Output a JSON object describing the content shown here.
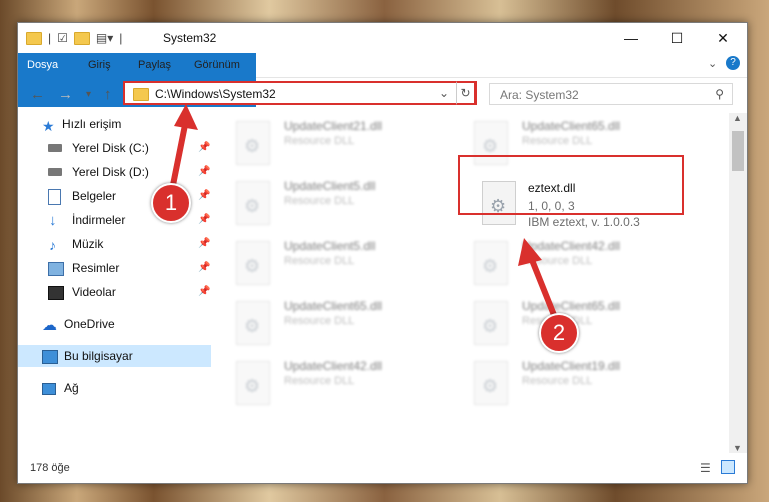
{
  "window": {
    "title": "System32"
  },
  "ribbon": {
    "tabs": [
      "Dosya",
      "Giriş",
      "Paylaş",
      "Görünüm"
    ]
  },
  "address": {
    "path": "C:\\Windows\\System32"
  },
  "search": {
    "placeholder": "Ara: System32"
  },
  "sidebar": {
    "items": [
      {
        "label": "Hızlı erişim",
        "icon": "star-icon",
        "pinned": false
      },
      {
        "label": "Yerel Disk (C:)",
        "icon": "drive-icon",
        "pinned": true
      },
      {
        "label": "Yerel Disk (D:)",
        "icon": "drive-icon",
        "pinned": true
      },
      {
        "label": "Belgeler",
        "icon": "documents-icon",
        "pinned": true
      },
      {
        "label": "İndirmeler",
        "icon": "download-icon",
        "pinned": true
      },
      {
        "label": "Müzik",
        "icon": "music-icon",
        "pinned": true
      },
      {
        "label": "Resimler",
        "icon": "pictures-icon",
        "pinned": true
      },
      {
        "label": "Videolar",
        "icon": "video-icon",
        "pinned": true
      },
      {
        "label": "OneDrive",
        "icon": "cloud-icon",
        "pinned": false
      },
      {
        "label": "Bu bilgisayar",
        "icon": "computer-icon",
        "pinned": false
      },
      {
        "label": "Ağ",
        "icon": "network-icon",
        "pinned": false
      }
    ]
  },
  "files": [
    {
      "name": "UpdateClient21.dll",
      "desc": "Resource DLL"
    },
    {
      "name": "UpdateClient65.dll",
      "desc": "Resource DLL"
    },
    {
      "name": "UpdateClient5.dll",
      "desc": "Resource DLL"
    },
    {
      "name": "eztext.dll",
      "desc": "1, 0, 0, 3",
      "desc2": "IBM eztext, v. 1.0.0.3"
    },
    {
      "name": "UpdateClient5.dll",
      "desc": "Resource DLL"
    },
    {
      "name": "UpdateClient42.dll",
      "desc": "Resource DLL"
    },
    {
      "name": "UpdateClient65.dll",
      "desc": "Resource DLL"
    },
    {
      "name": "UpdateClient65.dll",
      "desc": "Resource DLL"
    },
    {
      "name": "UpdateClient42.dll",
      "desc": "Resource DLL"
    },
    {
      "name": "UpdateClient19.dll",
      "desc": "Resource DLL"
    }
  ],
  "status": {
    "count": "178 öğe"
  },
  "annotations": {
    "step1": "1",
    "step2": "2"
  },
  "colors": {
    "accent": "#1979ca",
    "highlight": "#d9302d"
  }
}
